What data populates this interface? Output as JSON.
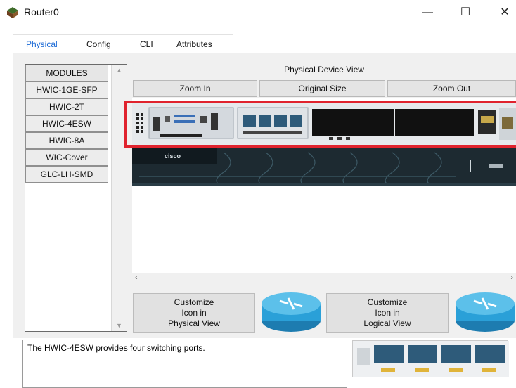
{
  "window": {
    "title": "Router0",
    "minimize": "—",
    "maximize": "☐",
    "close": "✕"
  },
  "tabs": [
    {
      "label": "Physical",
      "active": true
    },
    {
      "label": "Config"
    },
    {
      "label": "CLI"
    },
    {
      "label": "Attributes"
    }
  ],
  "modules": {
    "items": [
      "MODULES",
      "HWIC-1GE-SFP",
      "HWIC-2T",
      "HWIC-4ESW",
      "HWIC-8A",
      "WIC-Cover",
      "GLC-LH-SMD"
    ]
  },
  "device_view": {
    "title": "Physical Device View",
    "zoom_in": "Zoom In",
    "original_size": "Original Size",
    "zoom_out": "Zoom Out",
    "brand": "cisco"
  },
  "customize": {
    "physical": [
      "Customize",
      "Icon in",
      "Physical View"
    ],
    "logical": [
      "Customize",
      "Icon in",
      "Logical View"
    ]
  },
  "description": "The HWIC-4ESW provides four switching ports.",
  "colors": {
    "accent_tab": "#1b6ad6",
    "highlight": "#e0232e",
    "router_icon": "#2aa0d8"
  }
}
